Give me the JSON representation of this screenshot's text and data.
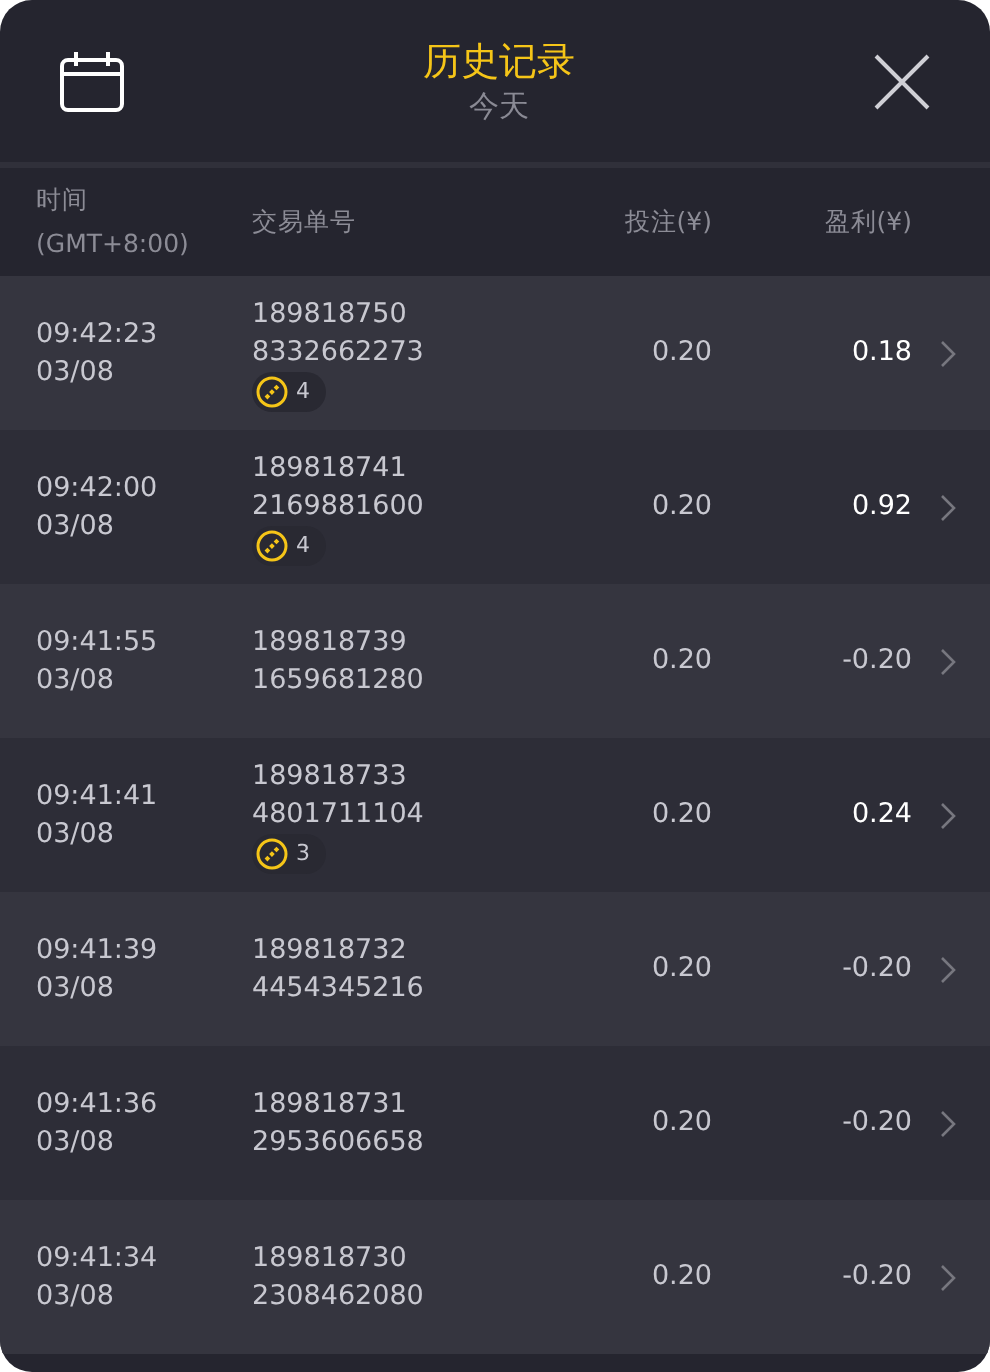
{
  "header": {
    "title": "历史记录",
    "subtitle": "今天"
  },
  "columns": [
    {
      "lines": [
        "时间",
        "(GMT+8:00)"
      ]
    },
    {
      "lines": [
        "交易单号"
      ]
    },
    {
      "lines": [
        "投注(¥)"
      ]
    },
    {
      "lines": [
        "盈利(¥)"
      ]
    }
  ],
  "rows": [
    {
      "time": "09:42:23",
      "date": "03/08",
      "ids": [
        "189818750",
        "8332662273"
      ],
      "badge": "4",
      "bet": "0.20",
      "profit": "0.18",
      "positive": true
    },
    {
      "time": "09:42:00",
      "date": "03/08",
      "ids": [
        "189818741",
        "2169881600"
      ],
      "badge": "4",
      "bet": "0.20",
      "profit": "0.92",
      "positive": true
    },
    {
      "time": "09:41:55",
      "date": "03/08",
      "ids": [
        "189818739",
        "1659681280"
      ],
      "bet": "0.20",
      "profit": "-0.20",
      "positive": false
    },
    {
      "time": "09:41:41",
      "date": "03/08",
      "ids": [
        "189818733",
        "4801711104"
      ],
      "badge": "3",
      "bet": "0.20",
      "profit": "0.24",
      "positive": true
    },
    {
      "time": "09:41:39",
      "date": "03/08",
      "ids": [
        "189818732",
        "4454345216"
      ],
      "bet": "0.20",
      "profit": "-0.20",
      "positive": false
    },
    {
      "time": "09:41:36",
      "date": "03/08",
      "ids": [
        "189818731",
        "2953606658"
      ],
      "bet": "0.20",
      "profit": "-0.20",
      "positive": false
    },
    {
      "time": "09:41:34",
      "date": "03/08",
      "ids": [
        "189818730",
        "2308462080"
      ],
      "bet": "0.20",
      "profit": "-0.20",
      "positive": false
    }
  ]
}
